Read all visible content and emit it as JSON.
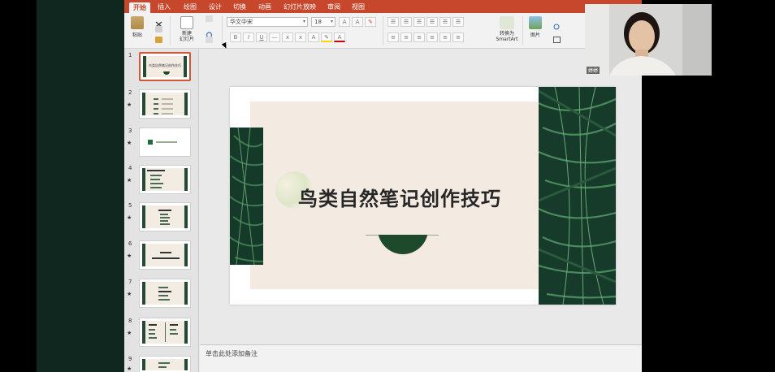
{
  "ribbon": {
    "tabs": [
      "开始",
      "插入",
      "绘图",
      "设计",
      "切换",
      "动画",
      "幻灯片放映",
      "审阅",
      "视图"
    ],
    "active_tab": "开始",
    "paste_label": "粘贴",
    "new_slide_label": "新建\n幻灯片",
    "font_name": "华文中宋",
    "font_size": "18",
    "convert_label": "转换为\nSmartArt",
    "picture_label": "图片"
  },
  "thumbnails": [
    {
      "num": "1",
      "text": "鸟类自然笔记创作技巧"
    },
    {
      "num": "2",
      "text": ""
    },
    {
      "num": "3",
      "text": ""
    },
    {
      "num": "4",
      "text": ""
    },
    {
      "num": "5",
      "text": ""
    },
    {
      "num": "6",
      "text": ""
    },
    {
      "num": "7",
      "text": ""
    },
    {
      "num": "8",
      "text": ""
    },
    {
      "num": "9",
      "text": ""
    }
  ],
  "slide": {
    "title": "鸟类自然笔记创作技巧"
  },
  "notes": {
    "placeholder": "单击此处添加备注"
  },
  "webcam": {
    "name": "婷婷"
  },
  "colors": {
    "ribbon_accent": "#c7472c",
    "slide_background": "#f3ebe1",
    "fern_green": "#1e4a2b"
  }
}
